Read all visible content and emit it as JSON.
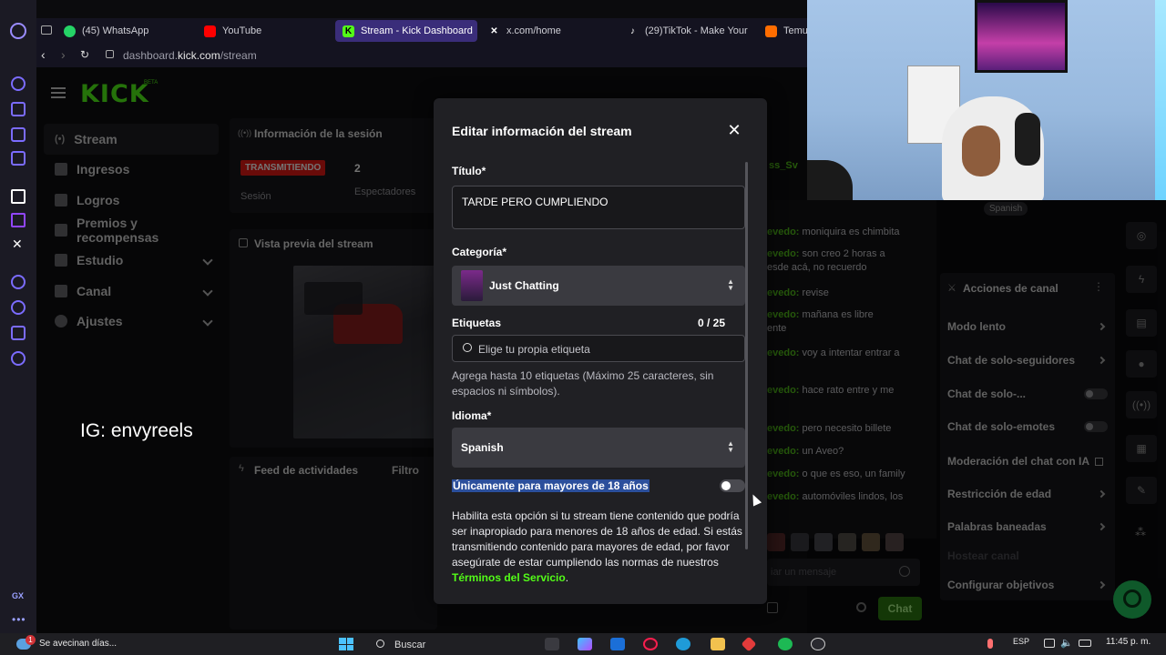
{
  "browser": {
    "tabs": [
      {
        "label": "(45) WhatsApp",
        "icon": "whatsapp-icon",
        "color": "#25d366"
      },
      {
        "label": "YouTube",
        "icon": "youtube-icon",
        "color": "#ff0000"
      },
      {
        "label": "Stream - Kick Dashboard",
        "icon": "kick-icon",
        "color": "#53fc18",
        "active": true
      },
      {
        "label": "x.com/home",
        "icon": "x-icon",
        "color": "#ffffff"
      },
      {
        "label": "(29)TikTok - Make Your",
        "icon": "tiktok-icon",
        "color": "#ffffff"
      },
      {
        "label": "Temu",
        "icon": "temu-icon",
        "color": "#ff6d00"
      }
    ],
    "url_prefix": "dashboard.",
    "url_domain": "kick.com",
    "url_path": "/stream",
    "opera_gx_label": "GX"
  },
  "dashboard": {
    "logo": "KICK",
    "logo_badge": "BETA",
    "nav": [
      {
        "label": "Stream"
      },
      {
        "label": "Ingresos"
      },
      {
        "label": "Logros"
      },
      {
        "label": "Premios y recompensas"
      },
      {
        "label": "Estudio"
      },
      {
        "label": "Canal"
      },
      {
        "label": "Ajustes"
      }
    ],
    "session_panel_title": "Información de la sesión",
    "live_badge": "TRANSMITIENDO",
    "session_label": "Sesión",
    "viewers_count": "2",
    "viewers_label": "Espectadores",
    "preview_title": "Vista previa del stream",
    "activity_title": "Feed de actividades",
    "activity_filter": "Filtro",
    "channel_actions_title": "Acciones de canal",
    "channel_actions": [
      {
        "label": "Modo lento",
        "control": "arrow"
      },
      {
        "label": "Chat de solo-seguidores",
        "control": "arrow"
      },
      {
        "label": "Chat de solo-...",
        "control": "toggle"
      },
      {
        "label": "Chat de solo-emotes",
        "control": "toggle"
      },
      {
        "label": "Moderación del chat con IA",
        "control": "external"
      },
      {
        "label": "Restricción de edad",
        "control": "arrow"
      },
      {
        "label": "Palabras baneadas",
        "control": "arrow"
      },
      {
        "label": "Hostear canal",
        "control": "none"
      },
      {
        "label": "Configurar objetivos",
        "control": "arrow"
      }
    ],
    "language_chip": "Spanish",
    "chat_top_user": "ss_Sv",
    "chat_messages": [
      {
        "user": "evedo:",
        "text": "moniquira es chimbita"
      },
      {
        "user": "evedo:",
        "text": "son creo 2 horas a",
        "cont": "esde acá, no recuerdo"
      },
      {
        "user": "evedo:",
        "text": "revise"
      },
      {
        "user": "evedo:",
        "text": "mañana es libre",
        "cont": "ente"
      },
      {
        "user": "evedo:",
        "text": "voy a intentar entrar a"
      },
      {
        "user": "evedo:",
        "text": "hace rato entre y me"
      },
      {
        "user": "evedo:",
        "text": "pero necesito billete"
      },
      {
        "user": "evedo:",
        "text": "un Aveo?"
      },
      {
        "user": "evedo:",
        "text": "o que es eso, un family"
      },
      {
        "user": "evedo:",
        "text": "automóviles lindos, los"
      }
    ],
    "chat_placeholder": "iar un mensaje",
    "chat_button": "Chat"
  },
  "modal": {
    "title": "Editar información del stream",
    "title_label": "Título*",
    "title_value": "TARDE PERO CUMPLIENDO",
    "category_label": "Categoría*",
    "category_value": "Just Chatting",
    "tags_label": "Etiquetas",
    "tags_count": "0 / 25",
    "tags_placeholder": "Elige tu propia etiqueta",
    "tags_help": "Agrega hasta 10 etiquetas (Máximo 25 caracteres, sin espacios ni símbolos).",
    "language_label": "Idioma*",
    "language_value": "Spanish",
    "mature_label": "Únicamente para mayores de 18 años",
    "mature_help": "Habilita esta opción si tu stream tiene contenido que podría ser inapropiado para menores de 18 años de edad. Si estás transmitiendo contenido para mayores de edad, por favor asegúrate de estar cumpliendo las normas de nuestros ",
    "tos_link": "Términos del Servicio",
    "tos_period": "."
  },
  "overlay_text": "IG: envyreels",
  "taskbar": {
    "weather_title": "Se avecinan días...",
    "weather_badge": "1",
    "search_label": "Buscar",
    "lang": "ESP",
    "time": "11:45 p. m."
  },
  "colors": {
    "accent": "#53fc18",
    "live": "#e91916",
    "modal_bg": "#202024"
  }
}
